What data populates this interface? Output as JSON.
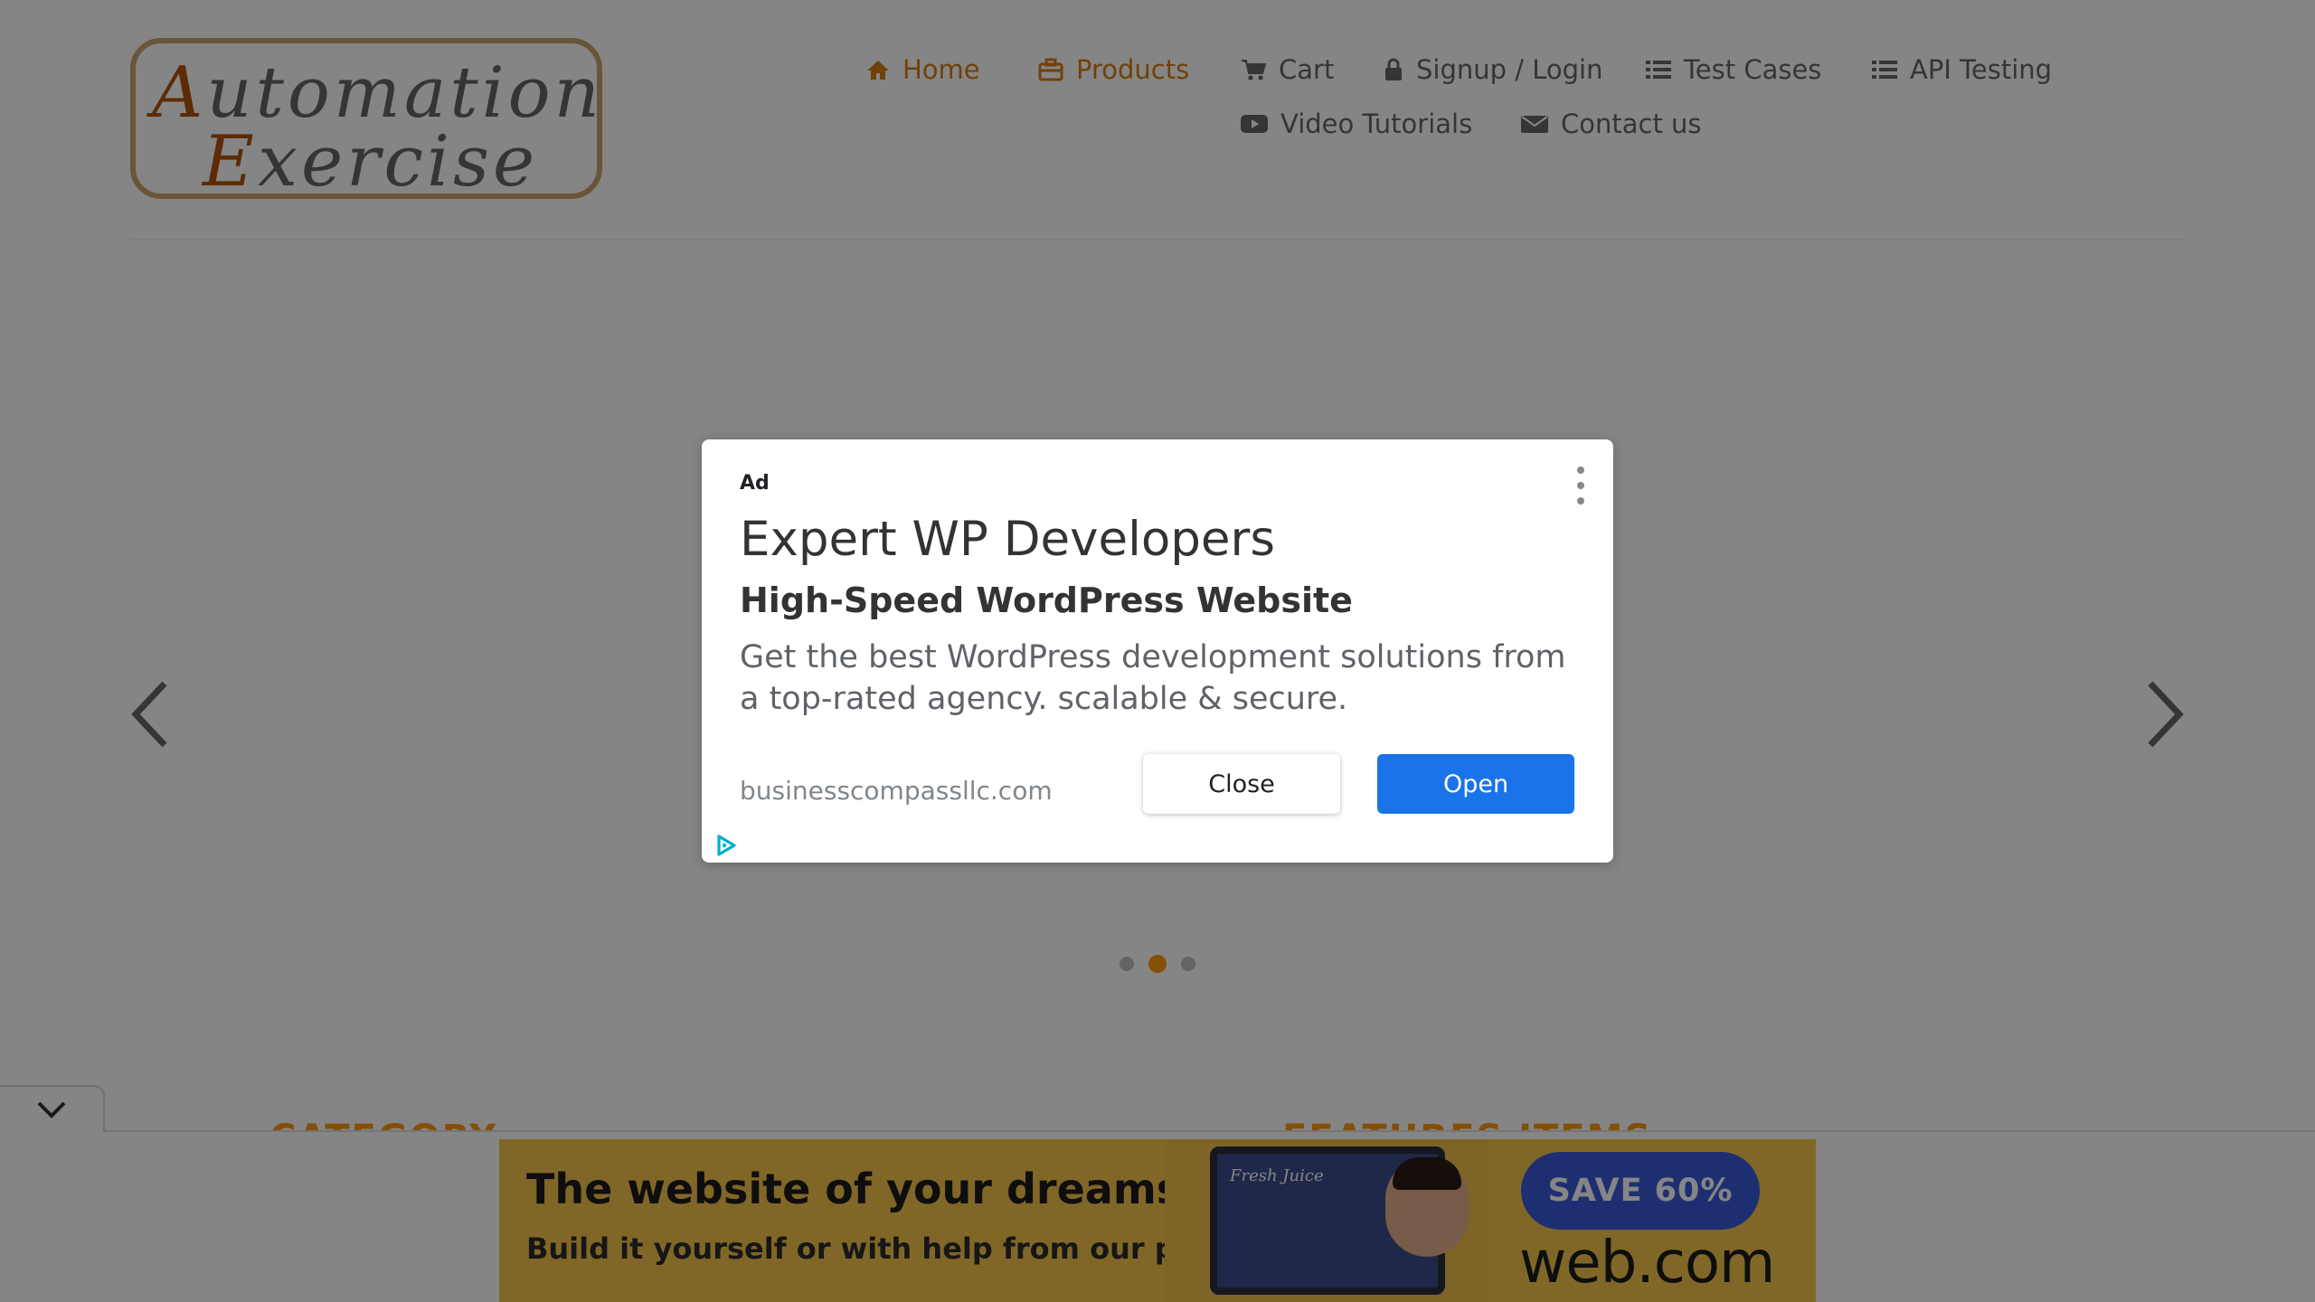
{
  "logo": {
    "line1_cap": "A",
    "line1_rest": "utomation",
    "line2_cap": "E",
    "line2_rest": "xercise"
  },
  "nav": {
    "items": [
      {
        "label": "Home",
        "icon": "home-icon",
        "active": true
      },
      {
        "label": "Products",
        "icon": "briefcase-icon",
        "active": true
      },
      {
        "label": "Cart",
        "icon": "cart-icon",
        "active": false
      },
      {
        "label": "Signup / Login",
        "icon": "lock-icon",
        "active": false
      },
      {
        "label": "Test Cases",
        "icon": "list-icon",
        "active": false
      },
      {
        "label": "API Testing",
        "icon": "list-icon",
        "active": false
      },
      {
        "label": "Video Tutorials",
        "icon": "youtube-icon",
        "active": false
      },
      {
        "label": "Contact us",
        "icon": "envelope-icon",
        "active": false
      }
    ],
    "active_color": "#d97e0e"
  },
  "carousel": {
    "dot_count": 3,
    "active_dot": 2,
    "prev_icon": "chevron-left-icon",
    "next_icon": "chevron-right-icon"
  },
  "sections": {
    "category": "CATEGORY",
    "features": "FEATURES ITEMS"
  },
  "ad_dialog": {
    "ad_label": "Ad",
    "title": "Expert WP Developers",
    "subtitle": "High-Speed WordPress Website",
    "body": "Get the best WordPress development solutions from a top-rated agency. scalable & secure.",
    "url": "businesscompassllc.com",
    "close_label": "Close",
    "open_label": "Open",
    "open_color": "#1a73e8"
  },
  "banner_ad": {
    "headline": "The website of your dreams",
    "subline": "Build it yourself or with help from our pros",
    "screen_text": "Fresh Juice",
    "cta": "SAVE 60%",
    "brand": "web.com"
  }
}
